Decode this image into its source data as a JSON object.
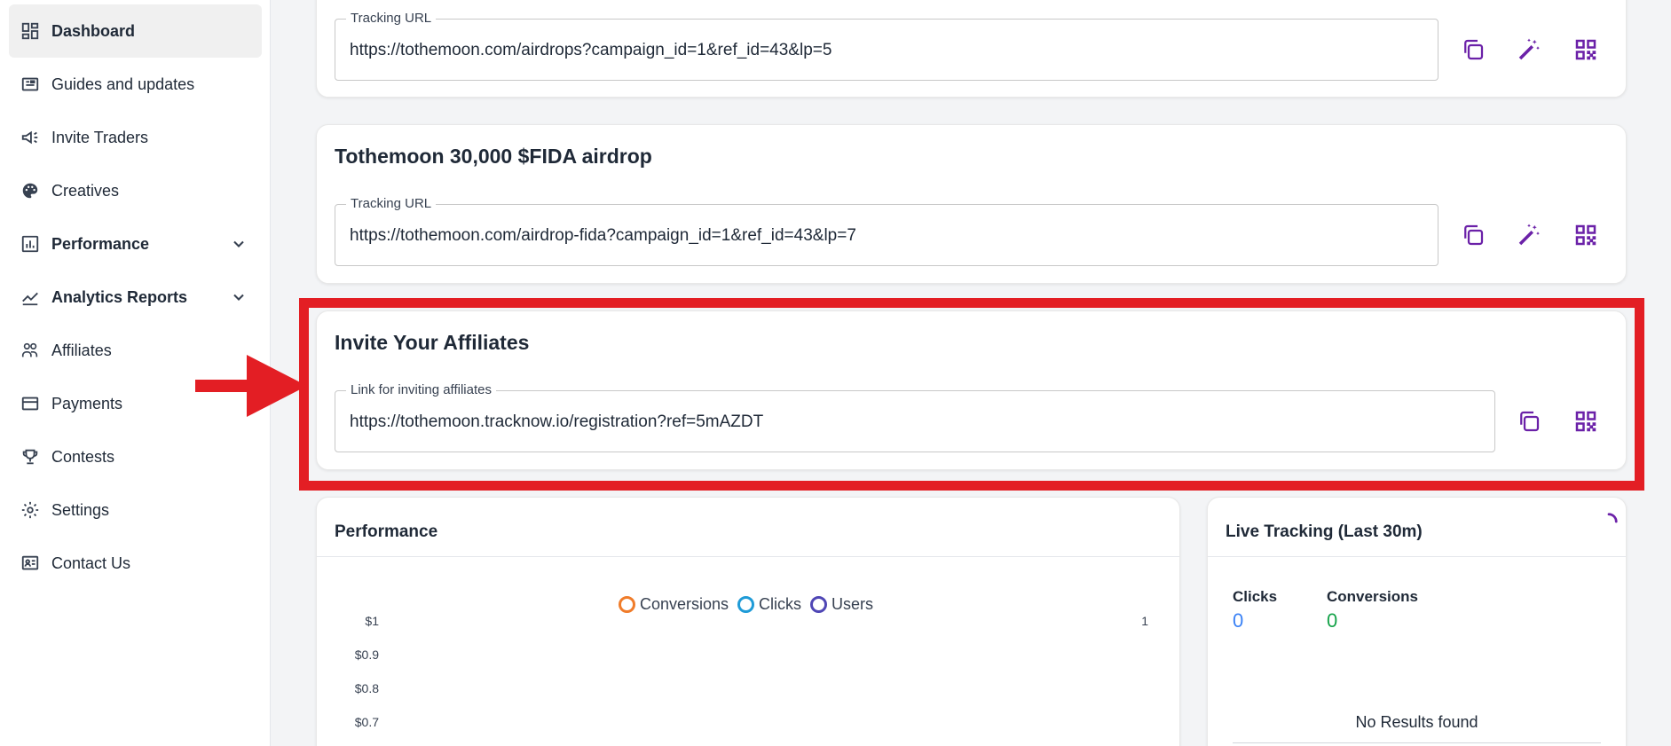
{
  "sidebar": {
    "items": [
      {
        "label": "Dashboard",
        "icon": "dashboard-icon"
      },
      {
        "label": "Guides and updates",
        "icon": "newspaper-icon"
      },
      {
        "label": "Invite Traders",
        "icon": "megaphone-icon"
      },
      {
        "label": "Creatives",
        "icon": "palette-icon"
      },
      {
        "label": "Performance",
        "icon": "bar-chart-icon"
      },
      {
        "label": "Analytics Reports",
        "icon": "line-chart-icon"
      },
      {
        "label": "Affiliates",
        "icon": "people-icon"
      },
      {
        "label": "Payments",
        "icon": "credit-card-icon"
      },
      {
        "label": "Contests",
        "icon": "trophy-icon"
      },
      {
        "label": "Settings",
        "icon": "gear-icon"
      },
      {
        "label": "Contact Us",
        "icon": "contact-card-icon"
      }
    ]
  },
  "campaigns": [
    {
      "field_label": "Tracking URL",
      "url": "https://tothemoon.com/airdrops?campaign_id=1&ref_id=43&lp=5"
    },
    {
      "title": "Tothemoon 30,000 $FIDA airdrop",
      "field_label": "Tracking URL",
      "url": "https://tothemoon.com/airdrop-fida?campaign_id=1&ref_id=43&lp=7"
    }
  ],
  "invite": {
    "title": "Invite Your Affiliates",
    "field_label": "Link for inviting affiliates",
    "url": "https://tothemoon.tracknow.io/registration?ref=5mAZDT"
  },
  "performance": {
    "title": "Performance",
    "legend": [
      {
        "name": "Conversions",
        "color": "#f07c2a"
      },
      {
        "name": "Clicks",
        "color": "#1f9bd7"
      },
      {
        "name": "Users",
        "color": "#4f46b5"
      }
    ],
    "y_ticks": [
      "$1",
      "$0.9",
      "$0.8",
      "$0.7"
    ],
    "y2_ticks": [
      "1"
    ]
  },
  "live_tracking": {
    "title": "Live Tracking (Last 30m)",
    "clicks_label": "Clicks",
    "clicks_value": "0",
    "conversions_label": "Conversions",
    "conversions_value": "0",
    "empty_text": "No Results found"
  },
  "colors": {
    "accent": "#6b21a8",
    "highlight": "#e31e24",
    "clicks_value": "#3b82f6",
    "conversions_value": "#16a34a"
  }
}
